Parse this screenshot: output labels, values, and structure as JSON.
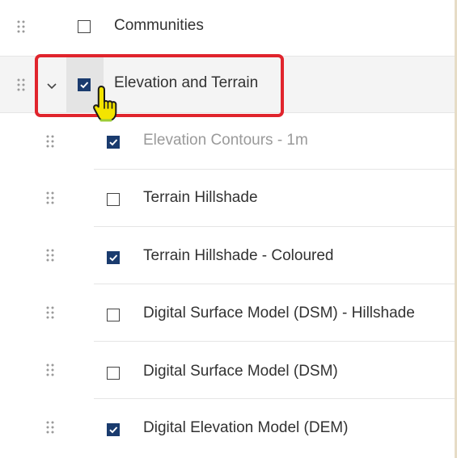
{
  "layer_list": {
    "top_item": {
      "label": "Communities",
      "checked": false
    },
    "group": {
      "label": "Elevation and Terrain",
      "checked": true,
      "expanded": true,
      "children": [
        {
          "label": "Elevation Contours - 1m",
          "checked": true,
          "dimmed": true
        },
        {
          "label": "Terrain Hillshade",
          "checked": false,
          "dimmed": false
        },
        {
          "label": "Terrain Hillshade - Coloured",
          "checked": true,
          "dimmed": false
        },
        {
          "label": "Digital Surface Model (DSM) - Hillshade",
          "checked": false,
          "dimmed": false
        },
        {
          "label": "Digital Surface Model (DSM)",
          "checked": false,
          "dimmed": false
        },
        {
          "label": "Digital Elevation Model (DEM)",
          "checked": true,
          "dimmed": false
        }
      ]
    }
  },
  "colors": {
    "checkbox_checked": "#1a3b6e",
    "highlight_box": "#e0242c",
    "cursor_fill": "#f3e400"
  },
  "icons": {
    "drag_handle": "drag-handle-icon",
    "expand": "chevron-down-icon",
    "cursor": "hand-pointer-cursor-icon"
  }
}
